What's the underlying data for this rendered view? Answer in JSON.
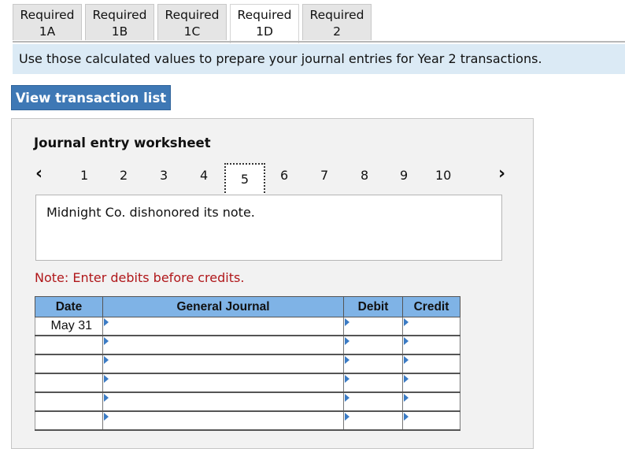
{
  "tabs": [
    {
      "line1": "Required",
      "line2": "1A",
      "active": false
    },
    {
      "line1": "Required",
      "line2": "1B",
      "active": false
    },
    {
      "line1": "Required",
      "line2": "1C",
      "active": false
    },
    {
      "line1": "Required",
      "line2": "1D",
      "active": true
    },
    {
      "line1": "Required",
      "line2": "2",
      "active": false
    }
  ],
  "instruction": "Use those calculated values to prepare your journal entries for Year 2 transactions.",
  "view_button_label": "View transaction list",
  "worksheet": {
    "title": "Journal entry worksheet",
    "prev_icon": "chevron-left-icon",
    "next_icon": "chevron-right-icon",
    "pages": [
      "1",
      "2",
      "3",
      "4",
      "5",
      "6",
      "7",
      "8",
      "9",
      "10"
    ],
    "current_page": "5",
    "description": "Midnight Co. dishonored its note.",
    "note": "Note: Enter debits before credits.",
    "table": {
      "headers": {
        "date": "Date",
        "journal": "General Journal",
        "debit": "Debit",
        "credit": "Credit"
      },
      "rows": [
        {
          "date": "May 31",
          "journal": "",
          "debit": "",
          "credit": ""
        },
        {
          "date": "",
          "journal": "",
          "debit": "",
          "credit": ""
        },
        {
          "date": "",
          "journal": "",
          "debit": "",
          "credit": ""
        },
        {
          "date": "",
          "journal": "",
          "debit": "",
          "credit": ""
        },
        {
          "date": "",
          "journal": "",
          "debit": "",
          "credit": ""
        },
        {
          "date": "",
          "journal": "",
          "debit": "",
          "credit": ""
        }
      ]
    }
  },
  "colors": {
    "banner_bg": "#dbeaf5",
    "button_bg": "#3e78b5",
    "table_header_bg": "#7fb3e6",
    "note_text": "#b0171a"
  }
}
